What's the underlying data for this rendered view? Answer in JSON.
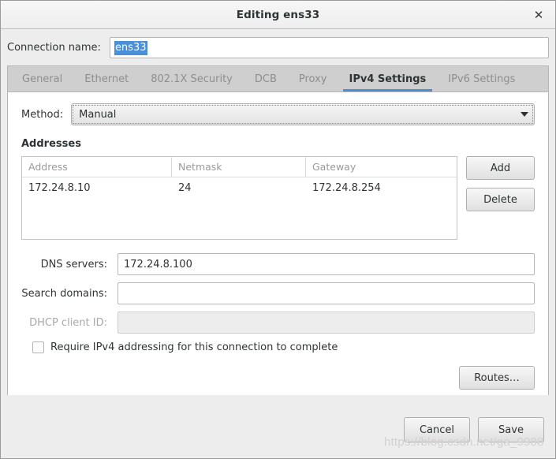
{
  "window": {
    "title": "Editing ens33",
    "close_icon": "close-icon",
    "close_glyph": "✕"
  },
  "connection": {
    "label": "Connection name:",
    "value": "ens33",
    "selected": true,
    "selection_color": "#4a90d9"
  },
  "tabs": {
    "active_index": 5,
    "accent_color": "#4a90d9",
    "items": [
      {
        "label": "General"
      },
      {
        "label": "Ethernet"
      },
      {
        "label": "802.1X Security"
      },
      {
        "label": "DCB"
      },
      {
        "label": "Proxy"
      },
      {
        "label": "IPv4 Settings"
      },
      {
        "label": "IPv6 Settings"
      }
    ]
  },
  "ipv4": {
    "method": {
      "label": "Method:",
      "value": "Manual",
      "arrow_icon": "chevron-down-icon"
    },
    "addresses": {
      "title": "Addresses",
      "columns": [
        "Address",
        "Netmask",
        "Gateway"
      ],
      "rows": [
        {
          "address": "172.24.8.10",
          "netmask": "24",
          "gateway": "172.24.8.254"
        }
      ],
      "add_label": "Add",
      "delete_label": "Delete"
    },
    "dns": {
      "label": "DNS servers:",
      "value": "172.24.8.100",
      "placeholder": ""
    },
    "search_domains": {
      "label": "Search domains:",
      "value": "",
      "placeholder": ""
    },
    "dhcp_client_id": {
      "label": "DHCP client ID:",
      "value": "",
      "placeholder": "",
      "disabled": true
    },
    "require_ipv4": {
      "label": "Require IPv4 addressing for this connection to complete",
      "checked": false
    },
    "routes_label": "Routes…"
  },
  "actions": {
    "cancel_label": "Cancel",
    "save_label": "Save"
  },
  "watermark": {
    "text": "https://blog.csdn.net/ga_9988"
  }
}
